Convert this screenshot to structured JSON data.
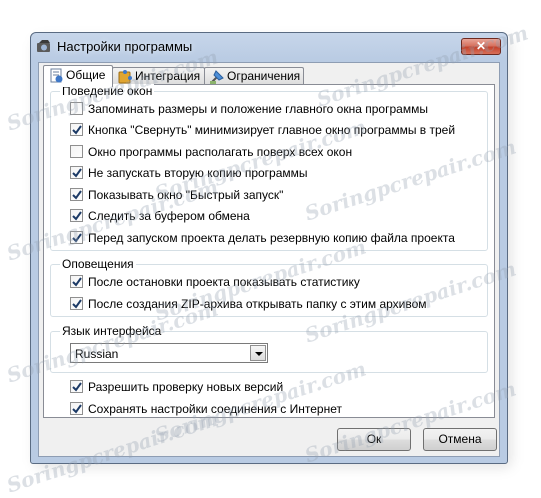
{
  "window": {
    "title": "Настройки программы",
    "close_symbol": "✕"
  },
  "tabs": [
    {
      "label": "Общие",
      "icon": "settings-page-icon",
      "active": true
    },
    {
      "label": "Интеграция",
      "icon": "puzzle-icon",
      "active": false
    },
    {
      "label": "Ограничения",
      "icon": "restrictions-icon",
      "active": false
    }
  ],
  "groups": {
    "window_behavior": {
      "label": "Поведение окон",
      "items": [
        {
          "label": "Запоминать размеры и положение главного окна программы",
          "checked": false
        },
        {
          "label": "Кнопка \"Свернуть\" минимизирует главное окно программы в трей",
          "checked": true
        },
        {
          "label": "Окно программы располагать поверх всех окон",
          "checked": false
        },
        {
          "label": "Не запускать вторую копию программы",
          "checked": true
        },
        {
          "label": "Показывать окно \"Быстрый запуск\"",
          "checked": true
        },
        {
          "label": "Следить за буфером обмена",
          "checked": true
        },
        {
          "label": "Перед запуском проекта делать резервную копию файла проекта",
          "checked": true
        }
      ]
    },
    "notifications": {
      "label": "Оповещения",
      "items": [
        {
          "label": "После остановки проекта показывать статистику",
          "checked": true
        },
        {
          "label": "После создания ZIP-архива открывать папку с этим архивом",
          "checked": true
        }
      ]
    },
    "language": {
      "label": "Язык интерфейса",
      "selected": "Russian"
    }
  },
  "standalone": [
    {
      "label": "Разрешить проверку новых версий",
      "checked": true
    },
    {
      "label": "Сохранять настройки соединения с Интернет",
      "checked": true
    }
  ],
  "buttons": {
    "ok": "Ок",
    "cancel": "Отмена"
  },
  "watermark": "Soringpcrepair.com",
  "colors": {
    "title_bar": "#b9cbe3",
    "close_button": "#c4432c",
    "check_mark": "#1c3a66",
    "dialog_bg": "#f0f0f0",
    "group_border": "#d5dfe5"
  }
}
